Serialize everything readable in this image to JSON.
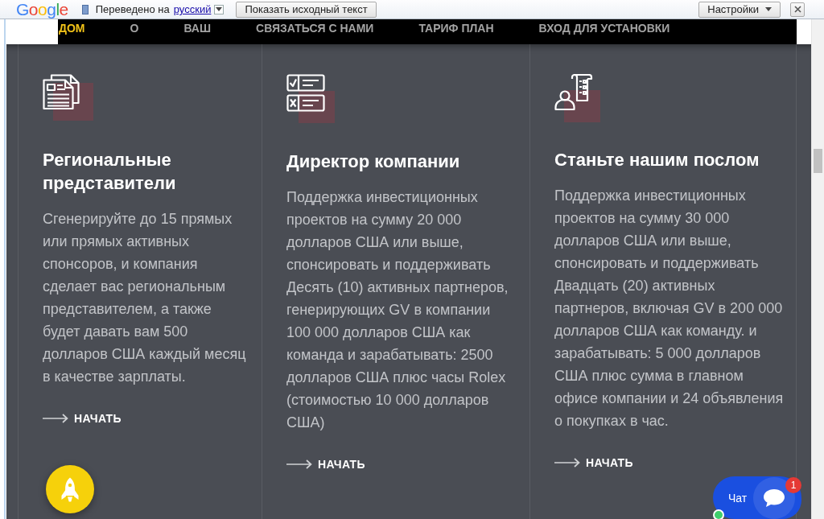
{
  "translate_bar": {
    "logo": "Google",
    "label": "Переведено на",
    "language": "русский",
    "show_original_button": "Показать исходный текст",
    "settings_button": "Настройки"
  },
  "nav": [
    {
      "label": "ДОМ",
      "selected": true
    },
    {
      "label": "О",
      "selected": false
    },
    {
      "label": "ВАШ",
      "selected": false
    },
    {
      "label": "СВЯЗАТЬСЯ С НАМИ",
      "selected": false
    },
    {
      "label": "ТАРИФ ПЛАН",
      "selected": false
    },
    {
      "label": "ВХОД ДЛЯ УСТАНОВКИ",
      "selected": false
    }
  ],
  "cards": [
    {
      "title": "Региональные представители",
      "text": "Сгенерируйте до 15 прямых или прямых активных спонсоров, и компания сделает вас региональным представителем, а также будет давать вам 500 долларов США каждый месяц в качестве зарплаты.",
      "link": "НАЧАТЬ"
    },
    {
      "title": "Директор компании",
      "text": "Поддержка инвестиционных проектов на сумму 20 000 долларов США или выше, спонсировать и поддерживать Десять (10) активных партнеров, генерирующих GV в компании 100 000 долларов США как команда и зарабатывать: 2500 долларов США плюс часы Rolex (стоимостью 10 000 долларов США)",
      "link": "НАЧАТЬ"
    },
    {
      "title": "Станьте нашим послом",
      "text": "Поддержка инвестиционных проектов на сумму 30 000 долларов США или выше, спонсировать и поддерживать Двадцать (20) активных партнеров, включая GV в 200 000 долларов США как команду. и зарабатывать: 5 000 долларов США плюс сумма в главном офисе компании и 24 объявления о покупках в час.",
      "link": "НАЧАТЬ"
    }
  ],
  "chat": {
    "label": "Чат",
    "badge": "1",
    "online": true
  }
}
